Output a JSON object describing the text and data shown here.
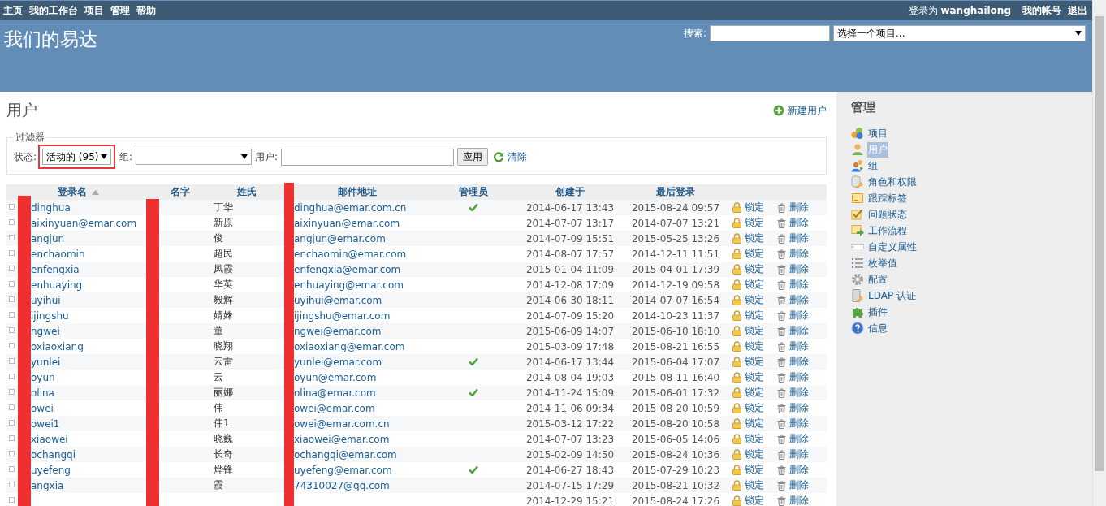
{
  "top_menu": [
    {
      "label": "主页"
    },
    {
      "label": "我的工作台"
    },
    {
      "label": "项目"
    },
    {
      "label": "管理"
    },
    {
      "label": "帮助"
    }
  ],
  "account": {
    "logged_in_as": "登录为 **wanghailong**",
    "links": [
      {
        "label": "我的帐号"
      },
      {
        "label": "退出"
      }
    ]
  },
  "header": {
    "title": "我们的易达",
    "search_label": "搜索:",
    "project_select": "选择一个项目..."
  },
  "page": {
    "title": "用户",
    "new_user": "新建用户"
  },
  "filter": {
    "legend": "过滤器",
    "status_label": "状态:",
    "status_value": "活动的 (95)",
    "status_highlighted": true,
    "group_label": "组:",
    "user_label": "用户:",
    "apply": "应用",
    "clear": "清除"
  },
  "table": {
    "columns": [
      {
        "label": "登录名",
        "sorted": true
      },
      {
        "label": "名字",
        "sorted": false
      },
      {
        "label": "姓氏",
        "sorted": false
      },
      {
        "label": "邮件地址",
        "sorted": false
      },
      {
        "label": "管理员",
        "sorted": false
      },
      {
        "label": "创建于",
        "sorted": false
      },
      {
        "label": "最后登录",
        "sorted": false
      }
    ],
    "rows": [
      {
        "login": "dinghua",
        "lastname": "丁华",
        "email": "dinghua@emar.com.cn",
        "admin": true,
        "created": "2014-06-17 13:43",
        "last_login": "2015-08-24 09:57",
        "lock": "锁定",
        "delete": "删除"
      },
      {
        "login": "aixinyuan@emar.com",
        "lastname": "新原",
        "email": "aixinyuan@emar.com",
        "admin": false,
        "created": "2014-07-07 13:17",
        "last_login": "2014-07-07 13:21",
        "lock": "锁定",
        "delete": "删除"
      },
      {
        "login": "angjun",
        "lastname": "俊",
        "email": "angjun@emar.com",
        "admin": false,
        "created": "2014-07-09 15:51",
        "last_login": "2015-05-25 13:26",
        "lock": "锁定",
        "delete": "删除"
      },
      {
        "login": "enchaomin",
        "lastname": "超民",
        "email": "enchaomin@emar.com",
        "admin": false,
        "created": "2014-08-07 17:57",
        "last_login": "2014-12-11 11:51",
        "lock": "锁定",
        "delete": "删除"
      },
      {
        "login": "enfengxia",
        "lastname": "凤霞",
        "email": "enfengxia@emar.com",
        "admin": false,
        "created": "2015-01-04 11:09",
        "last_login": "2015-04-01 17:39",
        "lock": "锁定",
        "delete": "删除"
      },
      {
        "login": "enhuaying",
        "lastname": "华英",
        "email": "enhuaying@emar.com",
        "admin": false,
        "created": "2014-12-08 17:09",
        "last_login": "2014-12-19 09:58",
        "lock": "锁定",
        "delete": "删除"
      },
      {
        "login": "uyihui",
        "lastname": "毅辉",
        "email": "uyihui@emar.com",
        "admin": false,
        "created": "2014-06-30 18:11",
        "last_login": "2014-07-07 16:54",
        "lock": "锁定",
        "delete": "删除"
      },
      {
        "login": "ijingshu",
        "lastname": "婧姝",
        "email": "ijingshu@emar.com",
        "admin": false,
        "created": "2014-07-09 15:20",
        "last_login": "2014-10-23 11:37",
        "lock": "锁定",
        "delete": "删除"
      },
      {
        "login": "ngwei",
        "lastname": "董",
        "email": "ngwei@emar.com",
        "admin": false,
        "created": "2015-06-09 14:07",
        "last_login": "2015-06-10 18:10",
        "lock": "锁定",
        "delete": "删除"
      },
      {
        "login": "oxiaoxiang",
        "lastname": "晓翔",
        "email": "oxiaoxiang@emar.com",
        "admin": false,
        "created": "2015-03-09 17:48",
        "last_login": "2015-08-21 16:55",
        "lock": "锁定",
        "delete": "删除"
      },
      {
        "login": "yunlei",
        "lastname": "云雷",
        "email": "yunlei@emar.com",
        "admin": true,
        "created": "2014-06-17 13:44",
        "last_login": "2015-06-04 17:07",
        "lock": "锁定",
        "delete": "删除"
      },
      {
        "login": "oyun",
        "lastname": "云",
        "email": "oyun@emar.com",
        "admin": false,
        "created": "2014-08-04 19:03",
        "last_login": "2015-08-11 16:40",
        "lock": "锁定",
        "delete": "删除"
      },
      {
        "login": "olina",
        "lastname": "丽娜",
        "email": "olina@emar.com",
        "admin": true,
        "created": "2014-11-24 15:09",
        "last_login": "2015-06-01 17:32",
        "lock": "锁定",
        "delete": "删除"
      },
      {
        "login": "owei",
        "lastname": "伟",
        "email": "owei@emar.com",
        "admin": false,
        "created": "2014-11-06 09:34",
        "last_login": "2015-08-20 10:59",
        "lock": "锁定",
        "delete": "删除"
      },
      {
        "login": "owei1",
        "lastname": "伟1",
        "email": "owei@emar.com.cn",
        "admin": false,
        "created": "2015-03-12 17:22",
        "last_login": "2015-08-20 10:58",
        "lock": "锁定",
        "delete": "删除"
      },
      {
        "login": "xiaowei",
        "lastname": "晓巍",
        "email": "xiaowei@emar.com",
        "admin": false,
        "created": "2014-07-07 13:23",
        "last_login": "2015-06-05 14:06",
        "lock": "锁定",
        "delete": "删除"
      },
      {
        "login": "ochangqi",
        "lastname": "长奇",
        "email": "ochangqi@emar.com",
        "admin": false,
        "created": "2015-02-09 14:50",
        "last_login": "2015-08-24 10:36",
        "lock": "锁定",
        "delete": "删除"
      },
      {
        "login": "uyefeng",
        "lastname": "烨锋",
        "email": "uyefeng@emar.com",
        "admin": true,
        "created": "2014-06-27 18:43",
        "last_login": "2015-07-29 10:23",
        "lock": "锁定",
        "delete": "删除"
      },
      {
        "login": "angxia",
        "lastname": "霞",
        "email": "74310027@qq.com",
        "admin": false,
        "created": "2014-07-15 17:29",
        "last_login": "2015-08-21 10:32",
        "lock": "锁定",
        "delete": "删除"
      },
      {
        "admin": false,
        "created": "2014-12-29 15:21",
        "last_login": "2015-08-24 17:26",
        "lock": "锁定",
        "delete": "删除"
      }
    ]
  },
  "sidebar": {
    "title": "管理",
    "items": [
      {
        "label": "项目",
        "kind": "projects",
        "selected": false
      },
      {
        "label": "用户",
        "kind": "users",
        "selected": true
      },
      {
        "label": "组",
        "kind": "groups",
        "selected": false
      },
      {
        "label": "角色和权限",
        "kind": "roles",
        "selected": false
      },
      {
        "label": "跟踪标签",
        "kind": "trackers",
        "selected": false
      },
      {
        "label": "问题状态",
        "kind": "statuses",
        "selected": false
      },
      {
        "label": "工作流程",
        "kind": "workflow",
        "selected": false
      },
      {
        "label": "自定义属性",
        "kind": "custom_fields",
        "selected": false
      },
      {
        "label": "枚举值",
        "kind": "enumerations",
        "selected": false
      },
      {
        "label": "配置",
        "kind": "settings",
        "selected": false
      },
      {
        "label": "LDAP 认证",
        "kind": "ldap",
        "selected": false
      },
      {
        "label": "插件",
        "kind": "plugins",
        "selected": false
      },
      {
        "label": "信息",
        "kind": "info",
        "selected": false
      }
    ]
  }
}
